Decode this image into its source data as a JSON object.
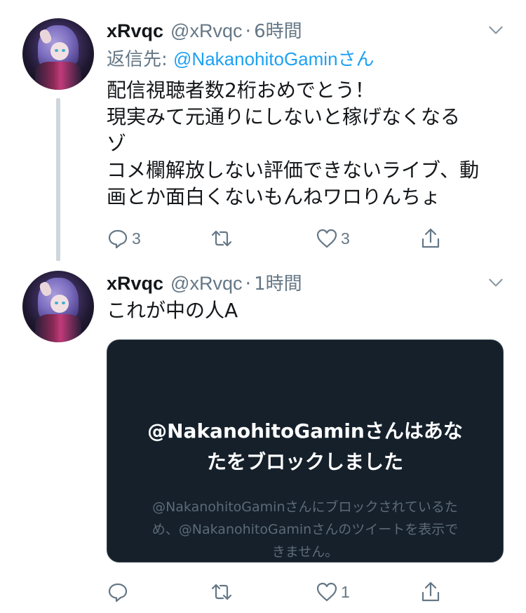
{
  "tweets": [
    {
      "name": "xRvqc",
      "handle": "@xRvqc",
      "separator": "·",
      "time": "6時間",
      "reply_prefix": "返信先: ",
      "reply_mention": "@NakanohitoGaminさん",
      "text": "配信視聴者数2桁おめでとう！\n現実みて元通りにしないと稼げなくなる\nゾ\nコメ欄解放しない評価できないライブ、動\n画とか面白くないもんねワロりんちょ",
      "reply_count": "3",
      "retweet_count": "",
      "like_count": "3"
    },
    {
      "name": "xRvqc",
      "handle": "@xRvqc",
      "separator": "·",
      "time": "1時間",
      "text": "これが中の人A",
      "quoted": {
        "title": "@NakanohitoGaminさんはあな\nたをブロックしました",
        "subtitle": "@NakanohitoGaminさんにブロックされているた\nめ、@NakanohitoGaminさんのツイートを表示で\nきません。"
      },
      "reply_count": "",
      "retweet_count": "",
      "like_count": "1"
    }
  ],
  "icons": [
    "reply-icon",
    "retweet-icon",
    "like-icon",
    "share-icon",
    "chevron-down-icon"
  ],
  "colors": {
    "link": "#1da1f2",
    "muted": "#657786",
    "card_bg": "#15202b"
  }
}
